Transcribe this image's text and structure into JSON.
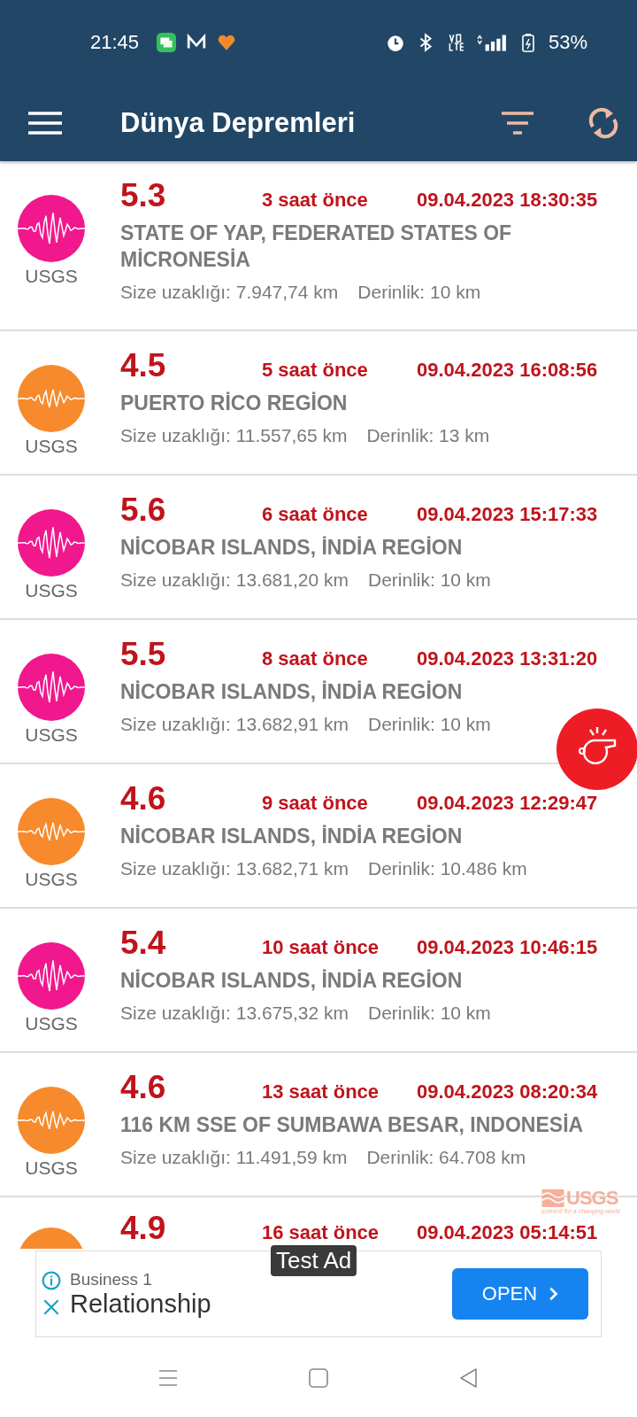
{
  "status_bar": {
    "time": "21:45",
    "battery": "53%"
  },
  "toolbar": {
    "title": "Dünya Depremleri"
  },
  "earthquakes": [
    {
      "source": "USGS",
      "color": "#f0188c",
      "magnitude": "5.3",
      "ago": "3 saat önce",
      "datetime": "09.04.2023 18:30:35",
      "region": "STATE OF YAP, FEDERATED STATES OF MİCRONESİA",
      "distance": "Size uzaklığı: 7.947,74 km",
      "depth": "Derinlik: 10 km"
    },
    {
      "source": "USGS",
      "color": "#f78a2c",
      "magnitude": "4.5",
      "ago": "5 saat önce",
      "datetime": "09.04.2023 16:08:56",
      "region": "PUERTO RİCO REGİON",
      "distance": "Size uzaklığı: 11.557,65 km",
      "depth": "Derinlik: 13 km"
    },
    {
      "source": "USGS",
      "color": "#f0188c",
      "magnitude": "5.6",
      "ago": "6 saat önce",
      "datetime": "09.04.2023 15:17:33",
      "region": "NİCOBAR ISLANDS, İNDİA REGİON",
      "distance": "Size uzaklığı: 13.681,20 km",
      "depth": "Derinlik: 10 km"
    },
    {
      "source": "USGS",
      "color": "#f0188c",
      "magnitude": "5.5",
      "ago": "8 saat önce",
      "datetime": "09.04.2023 13:31:20",
      "region": "NİCOBAR ISLANDS, İNDİA REGİON",
      "distance": "Size uzaklığı: 13.682,91 km",
      "depth": "Derinlik: 10 km"
    },
    {
      "source": "USGS",
      "color": "#f78a2c",
      "magnitude": "4.6",
      "ago": "9 saat önce",
      "datetime": "09.04.2023 12:29:47",
      "region": "NİCOBAR ISLANDS, İNDİA REGİON",
      "distance": "Size uzaklığı: 13.682,71 km",
      "depth": "Derinlik: 10.486 km"
    },
    {
      "source": "USGS",
      "color": "#f0188c",
      "magnitude": "5.4",
      "ago": "10 saat önce",
      "datetime": "09.04.2023 10:46:15",
      "region": "NİCOBAR ISLANDS, İNDİA REGİON",
      "distance": "Size uzaklığı: 13.675,32 km",
      "depth": "Derinlik: 10 km"
    },
    {
      "source": "USGS",
      "color": "#f78a2c",
      "magnitude": "4.6",
      "ago": "13 saat önce",
      "datetime": "09.04.2023 08:20:34",
      "region": "116 KM SSE OF SUMBAWA BESAR, INDONESİA",
      "distance": "Size uzaklığı: 11.491,59 km",
      "depth": "Derinlik: 64.708 km"
    },
    {
      "color": "#f78a2c",
      "magnitude": "4.9",
      "ago": "16 saat önce",
      "datetime": "09.04.2023 05:14:51"
    }
  ],
  "usgs_logo": {
    "name": "USGS",
    "tagline": "science for a changing world"
  },
  "ad": {
    "label": "Test Ad",
    "advertiser": "Business 1",
    "headline": "Relationship",
    "button": "OPEN"
  }
}
